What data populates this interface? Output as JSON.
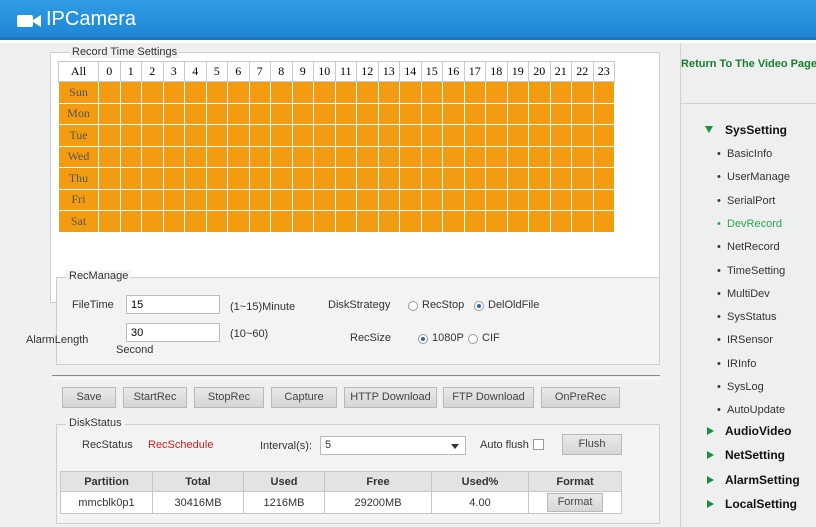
{
  "app": {
    "title": "IPCamera"
  },
  "colors": {
    "header": "#1f86d6",
    "schedule_cell": "#f39c12",
    "accent_green": "#1a8f3c",
    "status_red": "#d02020"
  },
  "schedule": {
    "title": "Record Time Settings",
    "all_label": "All",
    "hours": [
      "0",
      "1",
      "2",
      "3",
      "4",
      "5",
      "6",
      "7",
      "8",
      "9",
      "10",
      "11",
      "12",
      "13",
      "14",
      "15",
      "16",
      "17",
      "18",
      "19",
      "20",
      "21",
      "22",
      "23"
    ],
    "days": [
      "Sun",
      "Mon",
      "Tue",
      "Wed",
      "Thu",
      "Fri",
      "Sat"
    ]
  },
  "recmanage": {
    "title": "RecManage",
    "filetime_label": "FileTime",
    "filetime_value": "15",
    "filetime_hint": "(1~15)Minute",
    "diskstrategy_label": "DiskStrategy",
    "recstop_label": "RecStop",
    "deloldfile_label": "DelOldFile",
    "diskstrategy_selected": "DelOldFile",
    "alarmlength_label": "AlarmLength",
    "alarmlength_value": "30",
    "alarmlength_unit": "Second",
    "alarmlength_hint": "(10~60)",
    "recsize_label": "RecSize",
    "size_1080p_label": "1080P",
    "size_cif_label": "CIF",
    "recsize_selected": "1080P"
  },
  "buttons": {
    "save": "Save",
    "startrec": "StartRec",
    "stoprec": "StopRec",
    "capture": "Capture",
    "http_download": "HTTP Download",
    "ftp_download": "FTP Download",
    "onprerec": "OnPreRec"
  },
  "diskstatus": {
    "title": "DiskStatus",
    "recstatus_label": "RecStatus",
    "recstatus_value": "RecSchedule",
    "interval_label": "Interval(s):",
    "interval_value": "5",
    "autoflush_label": "Auto flush",
    "flush_label": "Flush",
    "columns": [
      "Partition",
      "Total",
      "Used",
      "Free",
      "Used%",
      "Format"
    ],
    "rows": [
      {
        "partition": "mmcblk0p1",
        "total": "30416MB",
        "used": "1216MB",
        "free": "29200MB",
        "used_pct": "4.00",
        "format": "Format"
      }
    ]
  },
  "sidebar": {
    "return_label": "Return To The Video Page",
    "sections": [
      {
        "label": "SysSetting",
        "expanded": true,
        "items": [
          "BasicInfo",
          "UserManage",
          "SerialPort",
          "DevRecord",
          "NetRecord",
          "TimeSetting",
          "MultiDev",
          "SysStatus",
          "IRSensor",
          "IRInfo",
          "SysLog",
          "AutoUpdate"
        ]
      },
      {
        "label": "AudioVideo",
        "expanded": false
      },
      {
        "label": "NetSetting",
        "expanded": false
      },
      {
        "label": "AlarmSetting",
        "expanded": false
      },
      {
        "label": "LocalSetting",
        "expanded": false
      }
    ],
    "active_item": "DevRecord"
  }
}
